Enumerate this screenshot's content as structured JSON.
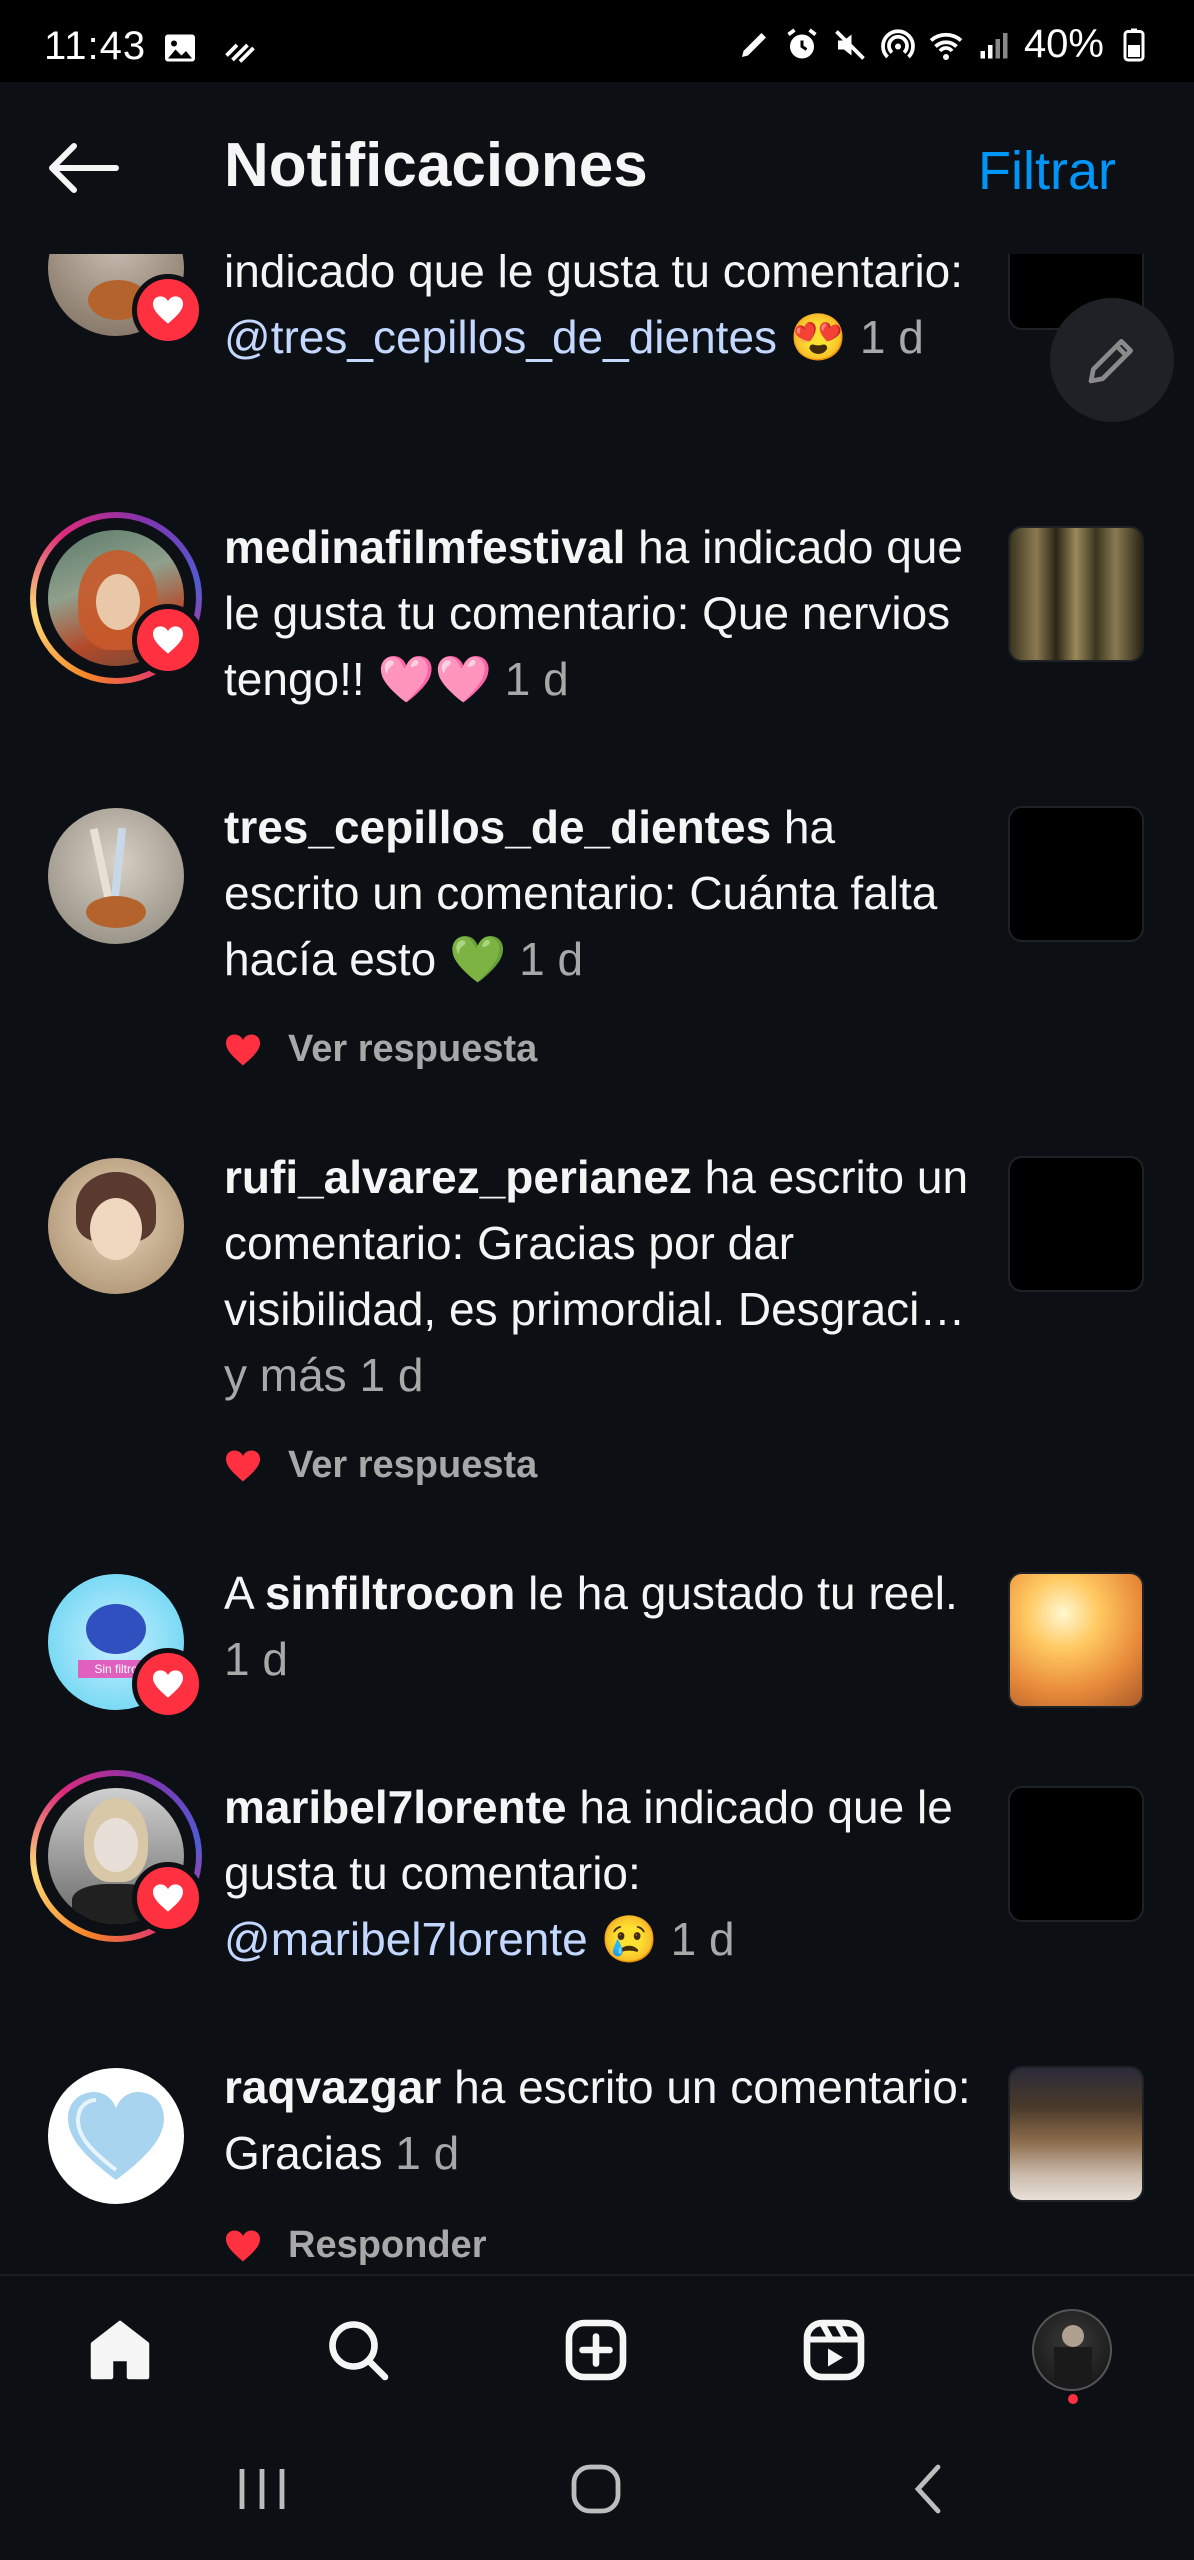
{
  "status_bar": {
    "time": "11:43",
    "battery": "40%"
  },
  "header": {
    "title": "Notificaciones",
    "filter_label": "Filtrar"
  },
  "notifications": [
    {
      "parts": {
        "main": "indicado que le gusta tu comentario: ",
        "mention": "@tres_cepillos_de_dientes",
        "emoji": "😍",
        "time": "1 d"
      }
    },
    {
      "username": "medinafilmfestival",
      "action": " ha indicado que le gusta tu comentario: Que nervios tengo!! ",
      "emoji": "🩷🩷",
      "time": "1 d"
    },
    {
      "username": "tres_cepillos_de_dientes",
      "action": " ha escrito un comentario: Cuánta falta hacía esto ",
      "emoji": "💚",
      "time": "1 d",
      "reply_label": "Ver respuesta"
    },
    {
      "username": "rufi_alvarez_perianez",
      "action": " ha escrito un comentario: Gracias por dar visibilidad, es primordial. Desgraci… ",
      "more": "y más",
      "time": "1 d",
      "reply_label": "Ver respuesta"
    },
    {
      "prefix": "A ",
      "username": "sinfiltrocon",
      "action": " le ha gustado tu reel. ",
      "time": "1 d",
      "avatar_label": "Sin filtro"
    },
    {
      "username": "maribel7lorente",
      "action": " ha indicado que le gusta tu comentario: ",
      "mention": "@maribel7lorente",
      "emoji": "😢",
      "time": "1 d"
    },
    {
      "username": "raqvazgar",
      "action": " ha escrito un comentario: Gracias ",
      "time": "1 d",
      "reply_label": "Responder"
    }
  ],
  "colors": {
    "background": "#0c1014",
    "accent": "#0095f6",
    "mention": "#c4d8ff",
    "secondary_text": "#a8a8a8",
    "like_red": "#ff3040"
  },
  "icons": {
    "back": "arrow-left-icon",
    "edit": "pencil-icon",
    "home": "home-icon",
    "search": "search-icon",
    "create": "plus-square-icon",
    "reels": "reels-icon",
    "profile": "avatar"
  }
}
